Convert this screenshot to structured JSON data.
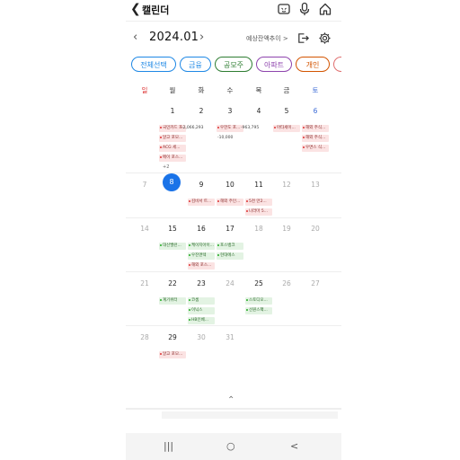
{
  "header": {
    "back_icon": "back-arrow-icon",
    "title": "캘린더",
    "icons": [
      "feedback-icon",
      "mic-icon",
      "home-icon"
    ]
  },
  "month_bar": {
    "prev": "‹",
    "month": "2024.01",
    "next": "›",
    "summary": "예상잔액추이 >",
    "icons": [
      "export-icon",
      "settings-icon"
    ]
  },
  "chips": [
    {
      "label": "전체선택",
      "color": "#1e88e5"
    },
    {
      "label": "금융",
      "color": "#1e88e5"
    },
    {
      "label": "공모주",
      "color": "#2e7d32"
    },
    {
      "label": "아파트",
      "color": "#8e44ad"
    },
    {
      "label": "개인",
      "color": "#d35400"
    },
    {
      "label": "",
      "color": "#e07070"
    }
  ],
  "weekdays": [
    "일",
    "월",
    "화",
    "수",
    "목",
    "금",
    "토"
  ],
  "weeks": [
    [
      {
        "d": "",
        "ev": []
      },
      {
        "d": "1",
        "ev": [
          [
            "red",
            "국민카드 포..."
          ],
          [
            "red",
            "알고 포모..."
          ],
          [
            "red",
            "ACG 세..."
          ],
          [
            "red",
            "메이 포스..."
          ]
        ],
        "more": "+2"
      },
      {
        "d": "2",
        "ev": [
          [
            "plain",
            "-2,066,293"
          ]
        ]
      },
      {
        "d": "3",
        "ev": [
          [
            "red",
            "우한도 포..."
          ],
          [
            "plain",
            "-10,000"
          ]
        ]
      },
      {
        "d": "4",
        "ev": [
          [
            "plain",
            "-963,795"
          ]
        ]
      },
      {
        "d": "5",
        "ev": [
          [
            "red",
            "아타세이..."
          ]
        ]
      },
      {
        "d": "6",
        "ev": [
          [
            "red",
            "해외 주식..."
          ],
          [
            "red",
            "해외 주식..."
          ],
          [
            "red",
            "우면스 식..."
          ]
        ]
      }
    ],
    [
      {
        "d": "7",
        "ev": []
      },
      {
        "d": "8",
        "today": true,
        "ev": []
      },
      {
        "d": "9",
        "ev": [
          [
            "red",
            "김비서 트..."
          ]
        ]
      },
      {
        "d": "10",
        "ev": [
          [
            "red",
            "해외 주인..."
          ]
        ]
      },
      {
        "d": "11",
        "ev": [
          [
            "red",
            "5천 만2..."
          ],
          [
            "red",
            "나라마 5..."
          ]
        ]
      },
      {
        "d": "12",
        "ev": []
      },
      {
        "d": "13",
        "ev": []
      }
    ],
    [
      {
        "d": "14",
        "ev": []
      },
      {
        "d": "15",
        "ev": [
          [
            "green",
            "대신밸런..."
          ]
        ]
      },
      {
        "d": "16",
        "ev": [
          [
            "green",
            "케이지아이..."
          ],
          [
            "green",
            "우진엔텍"
          ],
          [
            "red",
            "해외 포스..."
          ]
        ]
      },
      {
        "d": "17",
        "ev": [
          [
            "green",
            "포스뱅크"
          ],
          [
            "green",
            "현대에스"
          ]
        ]
      },
      {
        "d": "18",
        "ev": []
      },
      {
        "d": "19",
        "ev": []
      },
      {
        "d": "20",
        "ev": []
      }
    ],
    [
      {
        "d": "21",
        "ev": []
      },
      {
        "d": "22",
        "ev": [
          [
            "green",
            "계기위터"
          ]
        ]
      },
      {
        "d": "23",
        "ev": [
          [
            "green",
            "코셈"
          ],
          [
            "green",
            "이닉스"
          ],
          [
            "green",
            "HB인베..."
          ]
        ]
      },
      {
        "d": "24",
        "ev": []
      },
      {
        "d": "25",
        "ev": [
          [
            "green",
            "스토디오..."
          ],
          [
            "green",
            "선원스팩..."
          ]
        ]
      },
      {
        "d": "26",
        "ev": []
      },
      {
        "d": "27",
        "ev": []
      }
    ],
    [
      {
        "d": "28",
        "ev": []
      },
      {
        "d": "29",
        "ev": [
          [
            "red",
            "알고 포모..."
          ]
        ]
      },
      {
        "d": "30",
        "ev": []
      },
      {
        "d": "31",
        "ev": []
      },
      {
        "d": "",
        "ev": []
      },
      {
        "d": "",
        "ev": []
      },
      {
        "d": "",
        "ev": []
      }
    ]
  ],
  "collapse_icon": "chevron-up-icon",
  "collapse_glyph": "⌃",
  "navbar": {
    "recent": "|||",
    "home": "○",
    "back": "<"
  }
}
